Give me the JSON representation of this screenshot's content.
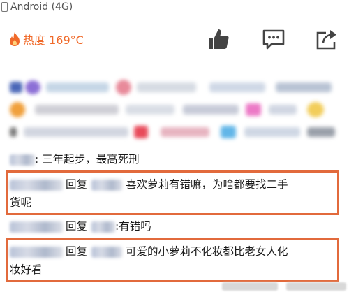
{
  "device": {
    "label": "Android (4G)"
  },
  "heat": {
    "label": "热度 169°C",
    "color": "#f06a2a"
  },
  "actions": {
    "like_icon": "thumbs-up-icon",
    "comment_icon": "chat-bubble-icon",
    "share_icon": "share-icon"
  },
  "comments": [
    {
      "text": ": 三年起步，最高死刑",
      "has_reply": false
    },
    {
      "reply_label": "回复",
      "text": " 喜欢萝莉有错嘛，为啥都要找二手",
      "text_line2": "货呢",
      "has_reply": true,
      "highlighted": true
    },
    {
      "reply_label": "回复",
      "text": ":有错吗",
      "has_reply": true,
      "highlighted": false
    },
    {
      "reply_label": "回复",
      "text": " 可爱的小萝莉不化妆都比老女人化",
      "text_line2": "妆好看",
      "has_reply": true,
      "highlighted": true
    }
  ],
  "colors": {
    "highlight_border": "#e26a3c",
    "icon_gray": "#444444"
  }
}
